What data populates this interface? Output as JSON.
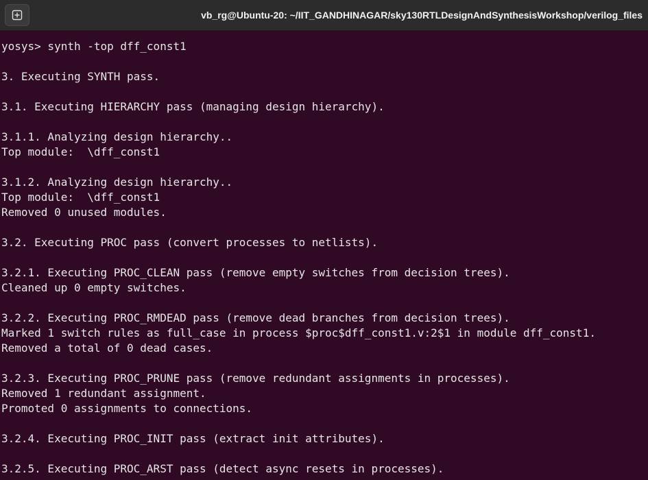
{
  "window": {
    "title": "vb_rg@Ubuntu-20: ~/IIT_GANDHINAGAR/sky130RTLDesignAndSynthesisWorkshop/verilog_files",
    "new_tab_icon": "new-tab-plus-icon"
  },
  "terminal": {
    "lines": [
      "yosys> synth -top dff_const1",
      "",
      "3. Executing SYNTH pass.",
      "",
      "3.1. Executing HIERARCHY pass (managing design hierarchy).",
      "",
      "3.1.1. Analyzing design hierarchy..",
      "Top module:  \\dff_const1",
      "",
      "3.1.2. Analyzing design hierarchy..",
      "Top module:  \\dff_const1",
      "Removed 0 unused modules.",
      "",
      "3.2. Executing PROC pass (convert processes to netlists).",
      "",
      "3.2.1. Executing PROC_CLEAN pass (remove empty switches from decision trees).",
      "Cleaned up 0 empty switches.",
      "",
      "3.2.2. Executing PROC_RMDEAD pass (remove dead branches from decision trees).",
      "Marked 1 switch rules as full_case in process $proc$dff_const1.v:2$1 in module dff_const1.",
      "Removed a total of 0 dead cases.",
      "",
      "3.2.3. Executing PROC_PRUNE pass (remove redundant assignments in processes).",
      "Removed 1 redundant assignment.",
      "Promoted 0 assignments to connections.",
      "",
      "3.2.4. Executing PROC_INIT pass (extract init attributes).",
      "",
      "3.2.5. Executing PROC_ARST pass (detect async resets in processes)."
    ]
  }
}
